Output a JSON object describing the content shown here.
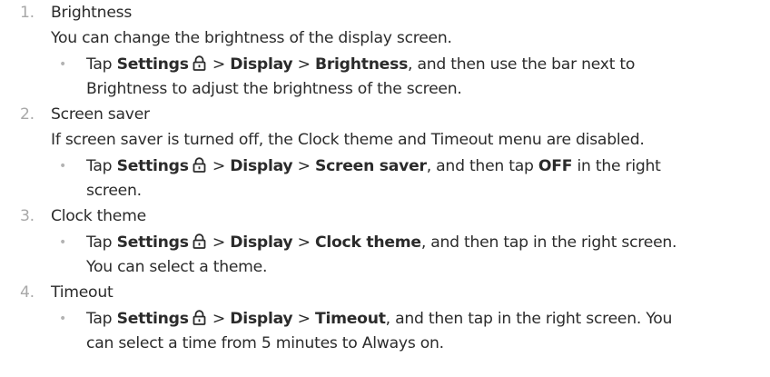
{
  "sep": " > ",
  "items": [
    {
      "number": "1.",
      "title": "Brightness",
      "description": "You can change the brightness of the display screen.",
      "bullet": "•",
      "step": {
        "tap": "Tap ",
        "settings": "Settings",
        "display": "Display",
        "target": "Brightness",
        "tail1": ", and then use the bar next to",
        "tail2": "Brightness to adjust the brightness of the screen."
      }
    },
    {
      "number": "2.",
      "title": "Screen saver",
      "description": "If screen saver is turned off, the Clock theme and Timeout menu are disabled.",
      "bullet": "•",
      "step": {
        "tap": "Tap ",
        "settings": "Settings",
        "display": "Display",
        "target": "Screen saver",
        "mid": ", and then tap ",
        "off": "OFF",
        "tail1": " in the right",
        "tail2": "screen."
      }
    },
    {
      "number": "3.",
      "title": "Clock theme",
      "bullet": "•",
      "step": {
        "tap": "Tap ",
        "settings": "Settings",
        "display": "Display",
        "target": "Clock theme",
        "tail1": ", and then tap in the right screen.",
        "tail2": "You can select a theme."
      }
    },
    {
      "number": "4.",
      "title": "Timeout",
      "bullet": "•",
      "step": {
        "tap": "Tap ",
        "settings": "Settings",
        "display": "Display",
        "target": "Timeout",
        "tail1": ", and then tap in the right screen. You",
        "tail2": "can select a time from 5 minutes to Always on."
      }
    }
  ]
}
